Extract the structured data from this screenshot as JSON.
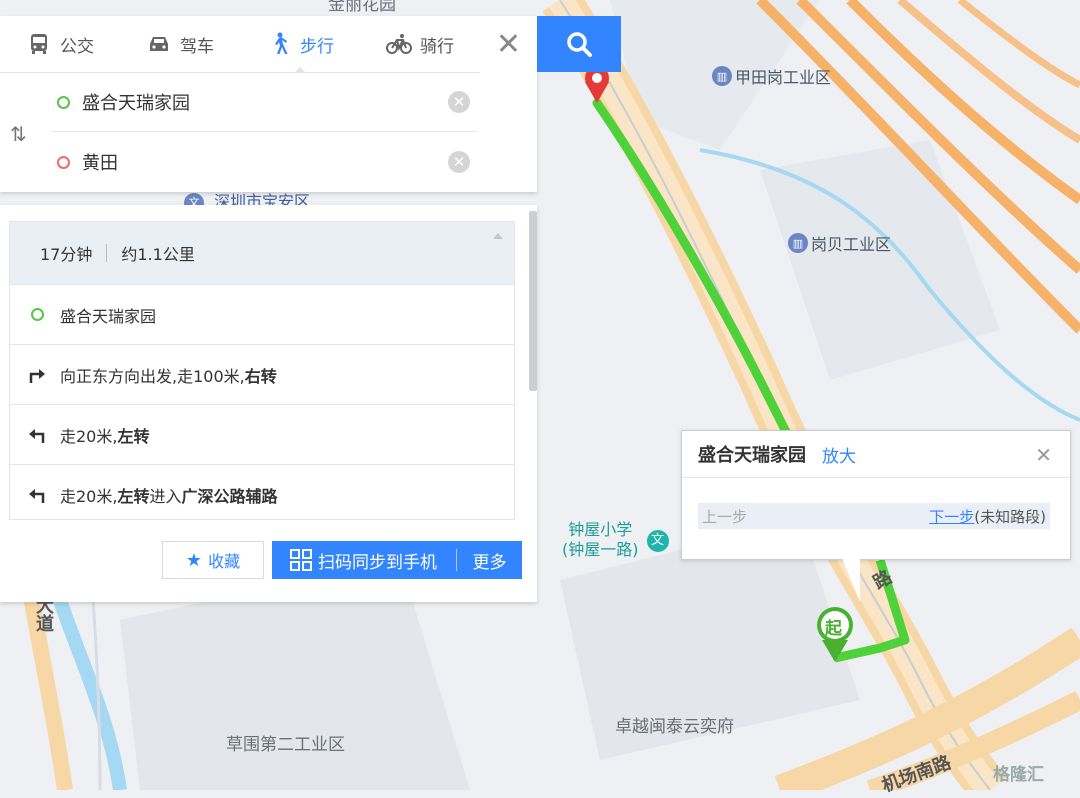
{
  "map": {
    "labels": {
      "top_cut": "金丽花园",
      "shenzhen_baoan": "深圳市宝安区",
      "caowei": "草围第二工业区",
      "zhuoyue": "卓越闽泰云奕府",
      "jichang_road": "机场南路",
      "road_char": "路",
      "dadao": "大道"
    },
    "pois": {
      "jiatian": "甲田岗工业区",
      "gangbei": "岗贝工业区"
    },
    "school": {
      "line1": "钟屋小学",
      "line2": "(钟屋一路)",
      "icon": "文"
    },
    "start_marker": "起",
    "route_color": "#4fd13a"
  },
  "tabs": [
    {
      "label": "公交",
      "icon": "bus-icon"
    },
    {
      "label": "驾车",
      "icon": "car-icon"
    },
    {
      "label": "步行",
      "icon": "walk-icon"
    },
    {
      "label": "骑行",
      "icon": "bike-icon"
    }
  ],
  "search": {
    "start": "盛合天瑞家园",
    "end": "黄田"
  },
  "route": {
    "time": "17分钟",
    "distance": "约1.1公里",
    "start_name": "盛合天瑞家园",
    "steps": [
      {
        "pre": "向正东方向出发,走100米,",
        "bold": "右转",
        "post": "",
        "icon": "turn-right-icon"
      },
      {
        "pre": "走20米,",
        "bold": "左转",
        "post": "",
        "icon": "turn-left-icon"
      },
      {
        "pre": "走20米,",
        "bold": "左转",
        "post": "进入",
        "bold2": "广深公路辅路",
        "icon": "turn-left-icon"
      }
    ]
  },
  "actions": {
    "favorite": "收藏",
    "qr": "扫码同步到手机",
    "more": "更多"
  },
  "popup": {
    "title": "盛合天瑞家园",
    "zoom": "放大",
    "prev": "上一步",
    "next": "下一步",
    "next_note": "(未知路段)"
  },
  "watermark": "格隆汇",
  "colors": {
    "accent": "#3385ff"
  }
}
